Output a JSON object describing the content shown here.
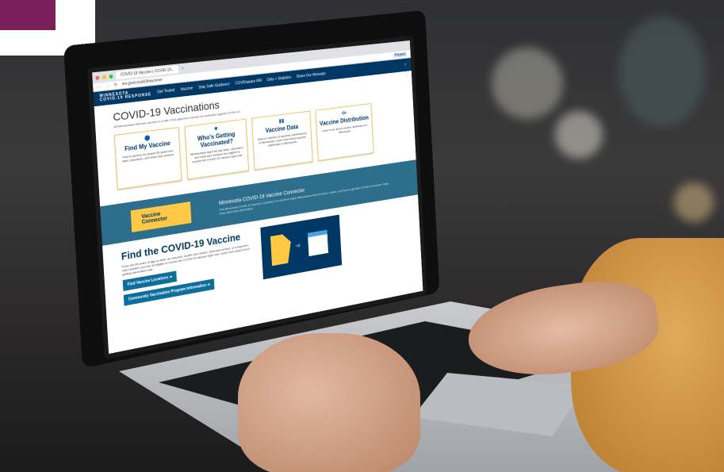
{
  "browser": {
    "tab_title": "COVID-19 Vaccine | COVID-19...",
    "url": "mn.gov/covid19/vaccine/",
    "profile_label": "Paused"
  },
  "site": {
    "logo_line1": "MINNESOTA",
    "logo_line2": "COVID-19 RESPONSE",
    "nav": [
      "Get Tested",
      "Vaccine",
      "Stay Safe Guidance",
      "COVIDaware MN",
      "Data + Statistics",
      "Share Our Message"
    ]
  },
  "page": {
    "title": "COVID-19 Vaccinations",
    "subtitle": "All Minnesotans will have access to a safe, FDA-approved vaccine for protection against COVID-19."
  },
  "cards": [
    {
      "title": "Find My Vaccine",
      "desc": "Find a vaccine for people 65 years and older, educators, and child care workers.",
      "icon": "location-pin-icon"
    },
    {
      "title": "Who's Getting Vaccinated?",
      "desc": "Minnesotans aged 65 and older, educators, and child care workers are eligible to receive the COVID-19 vaccine right now.",
      "icon": "people-icon"
    },
    {
      "title": "Vaccine Data",
      "desc": "Data on number of vaccines administered in Minnesota. Learn more about vaccine distribution in Minnesota.",
      "icon": "bar-chart-icon"
    },
    {
      "title": "Vaccine Distribution",
      "desc": "Learn more about vaccine distribution in Minnesota.",
      "icon": "distribution-icon"
    }
  ],
  "connector": {
    "button": "Vaccine Connector",
    "title": "Minnesota COVID-19 Vaccine Connector",
    "desc": "The Minnesota COVID-19 Vaccine Connector is a tool that helps Minnesotans find out when, where, and how to get their COVID-19 vaccine. Read more about this information."
  },
  "find": {
    "title": "Find the COVID-19 Vaccine",
    "desc": "If you are 65 years of age or older, an educator, health care worker, child care worker, or a long-term care resident, you are all eligible to receive the COVID-19 vaccine right now. Learn more about who's getting vaccinated now.",
    "btn1": "Find Vaccine Locations",
    "btn2": "Community Vaccination Program Information"
  },
  "colors": {
    "navy": "#003865",
    "gold": "#ffc845",
    "teal": "#2c6e8b",
    "purple_corner": "#7a1f5c"
  }
}
